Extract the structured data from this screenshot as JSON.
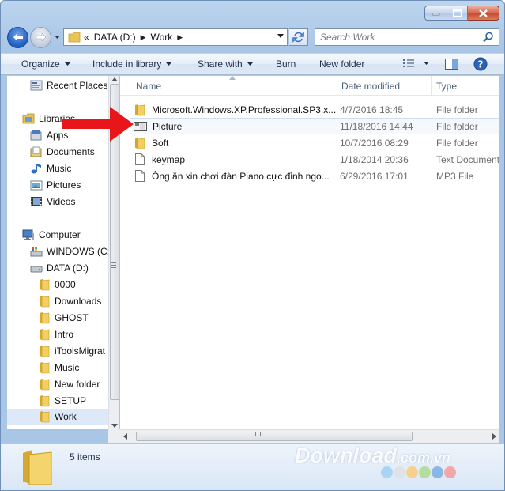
{
  "window": {
    "colors": {
      "accent": "#1f5fc0",
      "close": "#c44a2d",
      "arrow": "#e8161b"
    }
  },
  "address": {
    "overflow_glyph": "«",
    "segments": [
      "DATA (D:)",
      "Work"
    ]
  },
  "search": {
    "placeholder": "Search Work"
  },
  "toolbar": {
    "organize": "Organize",
    "include_in_library": "Include in library",
    "share_with": "Share with",
    "burn": "Burn",
    "new_folder": "New folder"
  },
  "navigation": {
    "recent_places": "Recent Places",
    "libraries": "Libraries",
    "apps": "Apps",
    "documents": "Documents",
    "music": "Music",
    "pictures": "Pictures",
    "videos": "Videos",
    "computer": "Computer",
    "windows_drive": "WINDOWS (C:",
    "data_drive": "DATA (D:)",
    "folders": [
      "0000",
      "Downloads",
      "GHOST",
      "Intro",
      "iToolsMigrat",
      "Music",
      "New folder",
      "SETUP",
      "Work"
    ]
  },
  "columns": {
    "name": "Name",
    "date_modified": "Date modified",
    "type": "Type"
  },
  "files": [
    {
      "name": "Microsoft.Windows.XP.Professional.SP3.x...",
      "date": "4/7/2016 18:45",
      "type": "File folder",
      "icon": "folder-icon"
    },
    {
      "name": "Picture",
      "date": "11/18/2016 14:44",
      "type": "File folder",
      "icon": "shortcut-folder-icon"
    },
    {
      "name": "Soft",
      "date": "10/7/2016 08:29",
      "type": "File folder",
      "icon": "folder-icon"
    },
    {
      "name": "keymap",
      "date": "1/18/2014 20:36",
      "type": "Text Document",
      "icon": "text-document-icon"
    },
    {
      "name": "Ông ăn xin chơi đàn Piano cực đỉnh ngo...",
      "date": "6/29/2016 17:01",
      "type": "MP3 File",
      "icon": "audio-file-icon"
    }
  ],
  "status": {
    "item_count": "5 items"
  },
  "watermark": {
    "text": "Download",
    "suffix": ".com.vn"
  }
}
